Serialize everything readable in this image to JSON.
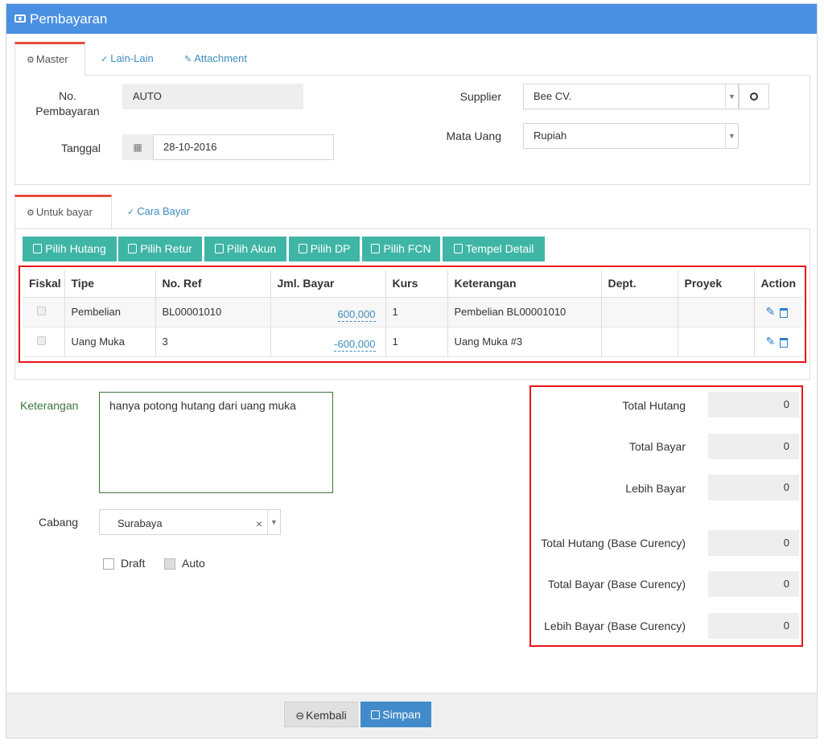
{
  "header": {
    "title": "Pembayaran"
  },
  "tabs_master": [
    {
      "label": "Master"
    },
    {
      "label": "Lain-Lain"
    },
    {
      "label": "Attachment"
    }
  ],
  "master": {
    "no_pembayaran_label": "No. Pembayaran",
    "no_pembayaran_value": "AUTO",
    "tanggal_label": "Tanggal",
    "tanggal_value": "28-10-2016",
    "supplier_label": "Supplier",
    "supplier_value": "Bee CV.",
    "mata_uang_label": "Mata Uang",
    "mata_uang_value": "Rupiah"
  },
  "tabs_detail": [
    {
      "label": "Untuk bayar"
    },
    {
      "label": "Cara Bayar"
    }
  ],
  "actions": [
    {
      "label": "Pilih Hutang"
    },
    {
      "label": "Pilih Retur"
    },
    {
      "label": "Pilih Akun"
    },
    {
      "label": "Pilih DP"
    },
    {
      "label": "Pilih FCN"
    },
    {
      "label": "Tempel Detail"
    }
  ],
  "table": {
    "columns": [
      "Fiskal",
      "Tipe",
      "No. Ref",
      "Jml. Bayar",
      "Kurs",
      "Keterangan",
      "Dept.",
      "Proyek",
      "Action"
    ],
    "rows": [
      {
        "tipe": "Pembelian",
        "no_ref": "BL00001010",
        "jml_bayar": "600,000",
        "kurs": "1",
        "keterangan": "Pembelian BL00001010",
        "dept": "",
        "proyek": ""
      },
      {
        "tipe": "Uang Muka",
        "no_ref": "3",
        "jml_bayar": "-600,000",
        "kurs": "1",
        "keterangan": "Uang Muka #3",
        "dept": "",
        "proyek": ""
      }
    ]
  },
  "form": {
    "keterangan_label": "Keterangan",
    "keterangan_value": "hanya potong hutang dari uang muka",
    "cabang_label": "Cabang",
    "cabang_value": "Surabaya",
    "draft_label": "Draft",
    "auto_label": "Auto"
  },
  "summary": [
    {
      "label": "Total Hutang",
      "value": "0"
    },
    {
      "label": "Total Bayar",
      "value": "0"
    },
    {
      "label": "Lebih Bayar",
      "value": "0"
    },
    {
      "label": "Total Hutang (Base Curency)",
      "value": "0"
    },
    {
      "label": "Total Bayar (Base Curency)",
      "value": "0"
    },
    {
      "label": "Lebih Bayar (Base Curency)",
      "value": "0"
    }
  ],
  "footer": {
    "kembali_label": "Kembali",
    "simpan_label": "Simpan"
  },
  "colors": {
    "header_blue": "#4a90e2",
    "teal": "#3fb5a6",
    "highlight_red": "#e8151b",
    "link_blue": "#3c8dbc"
  }
}
